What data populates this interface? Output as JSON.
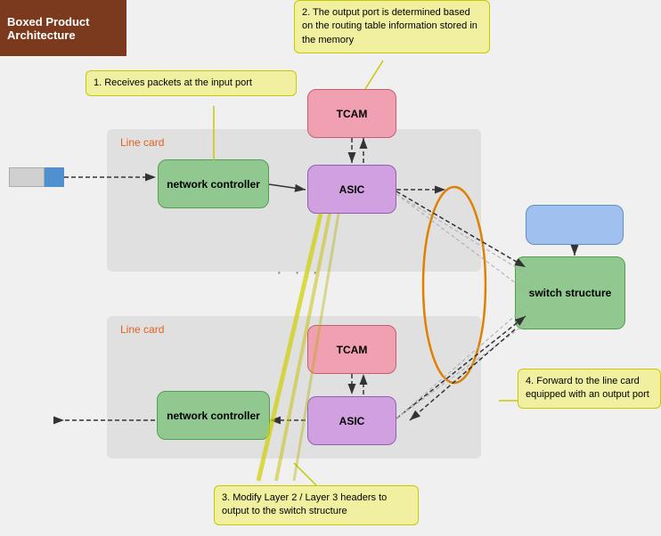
{
  "title": "Boxed Product Architecture",
  "callout1": "1. Receives packets at the input port",
  "callout2": "2. The output port is determined based on the routing table information stored in the memory",
  "callout3": "3. Modify Layer 2 / Layer 3 headers to output to the switch structure",
  "callout4": "4. Forward to the line card equipped with an output port",
  "linecard_label": "Line card",
  "tcam_label": "TCAM",
  "asic_label": "ASIC",
  "netctrl_label": "network controller",
  "switch_label": "switch structure"
}
